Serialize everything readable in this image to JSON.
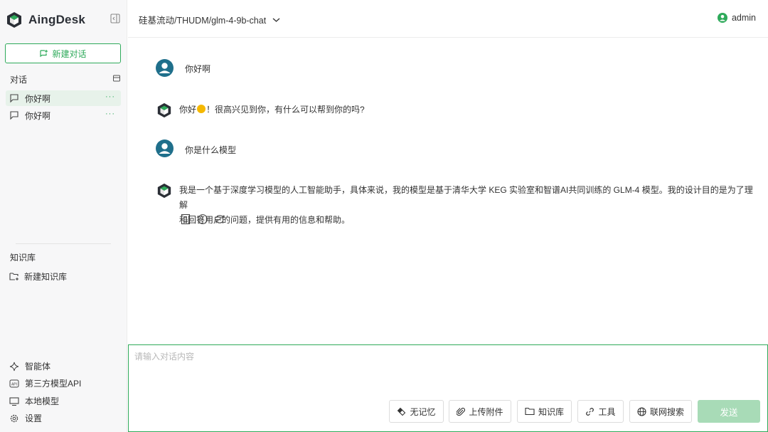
{
  "app": {
    "name": "AingDesk"
  },
  "colors": {
    "accent": "#2eaa5a",
    "send_disabled": "#a8dbb7",
    "user_avatar": "#1f6f8b"
  },
  "sidebar": {
    "new_chat_label": "新建对话",
    "dialog_section_label": "对话",
    "conversations": [
      {
        "title": "你好啊",
        "active": true,
        "more": "···"
      },
      {
        "title": "你好啊",
        "active": false,
        "more": "···"
      }
    ],
    "kb_section_label": "知识库",
    "new_kb_label": "新建知识库",
    "bottom_nav": [
      {
        "label": "智能体",
        "icon": "sparkle-icon"
      },
      {
        "label": "第三方模型API",
        "icon": "api-icon"
      },
      {
        "label": "本地模型",
        "icon": "monitor-icon"
      },
      {
        "label": "设置",
        "icon": "gear-icon"
      }
    ]
  },
  "header": {
    "model": "硅基流动/THUDM/glm-4-9b-chat",
    "user": "admin"
  },
  "messages": [
    {
      "role": "user",
      "text": "你好啊"
    },
    {
      "role": "assistant",
      "text_before": "你好",
      "emoji": "wave-hand-emoji",
      "text_after": "！很高兴见到你，有什么可以帮到你的吗?"
    },
    {
      "role": "user",
      "text": "你是什么模型"
    },
    {
      "role": "assistant",
      "line1": "我是一个基于深度学习模型的人工智能助手，具体来说，我的模型是基于清华大学 KEG 实验室和智谱AI共同训练的 GLM-4 模型。我的设计目的是为了理解",
      "line2": "和回答用户的问题，提供有用的信息和帮助。"
    }
  ],
  "message_actions": [
    "document-icon",
    "info-icon",
    "refresh-icon"
  ],
  "input": {
    "placeholder": "请输入对话内容",
    "buttons": {
      "no_memory": "无记忆",
      "upload": "上传附件",
      "knowledge": "知识库",
      "tools": "工具",
      "web_search": "联网搜索"
    },
    "send_label": "发送"
  }
}
